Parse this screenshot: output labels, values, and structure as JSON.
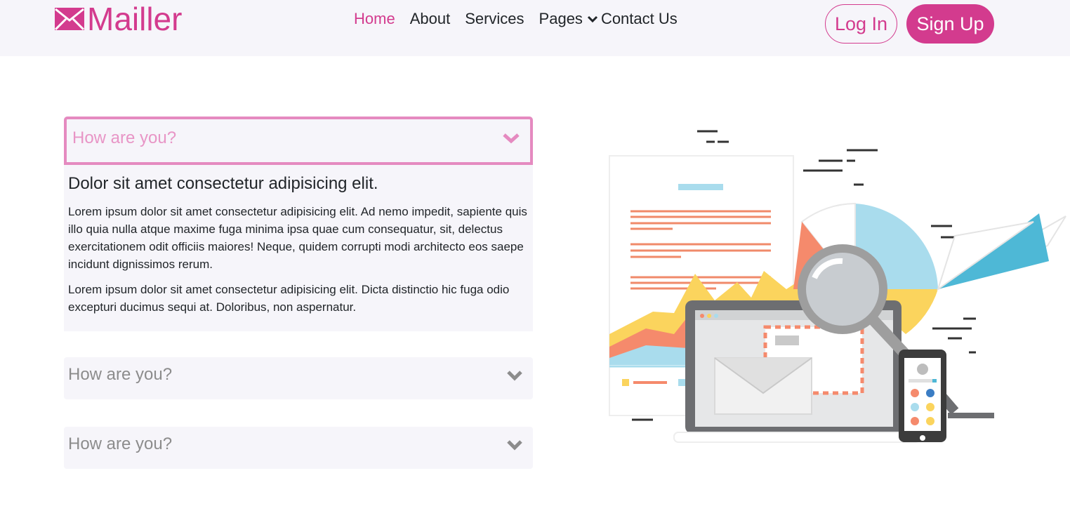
{
  "header": {
    "logo_text": "Mailler",
    "nav": {
      "home": "Home",
      "about": "About",
      "services": "Services",
      "pages": "Pages",
      "contact": "Contact Us"
    },
    "login_label": "Log In",
    "signup_label": "Sign Up"
  },
  "accordion": {
    "items": [
      {
        "question": "How are you?",
        "expanded": true,
        "heading": "Dolor sit amet consectetur adipisicing elit.",
        "paragraphs": [
          "Lorem ipsum dolor sit amet consectetur adipisicing elit. Ad nemo impedit, sapiente quis illo quia nulla atque maxime fuga minima ipsa quae cum consequatur, sit, delectus exercitationem odit officiis maiores! Neque, quidem corrupti modi architecto eos saepe incidunt dignissimos rerum.",
          "Lorem ipsum dolor sit amet consectetur adipisicing elit. Dicta distinctio hic fuga odio excepturi ducimus sequi at. Doloribus, non aspernatur."
        ]
      },
      {
        "question": "How are you?",
        "expanded": false
      },
      {
        "question": "How are you?",
        "expanded": false
      }
    ]
  },
  "colors": {
    "brand": "#d33b8e",
    "accent_light": "#e58ac0",
    "panel_bg": "#f6f5fa"
  },
  "icons": {
    "logo": "envelope-icon",
    "dropdown": "chevron-down-icon",
    "accordion_toggle": "chevron-down-icon"
  }
}
